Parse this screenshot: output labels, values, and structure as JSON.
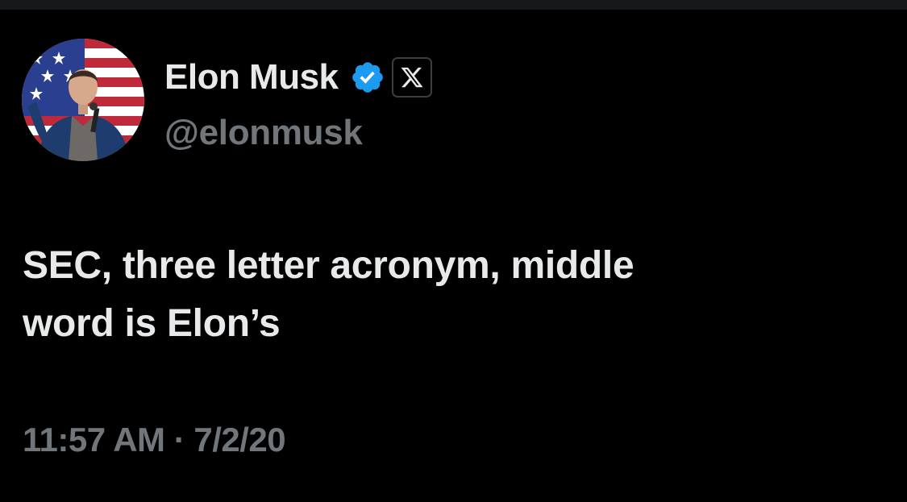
{
  "tweet": {
    "author": {
      "display_name": "Elon Musk",
      "handle": "@elonmusk",
      "verified_color": "#1d9bf0",
      "avatar_icon": "profile-photo",
      "affiliate_icon": "x-logo-icon"
    },
    "text_line1": "SEC, three letter acronym, middle",
    "text_line2": "word is Elon’s",
    "time": "11:57 AM",
    "separator": "·",
    "date": "7/2/20"
  },
  "colors": {
    "background": "#000000",
    "primary_text": "#e7e9ea",
    "secondary_text": "#71767b",
    "verified_badge": "#1d9bf0"
  }
}
